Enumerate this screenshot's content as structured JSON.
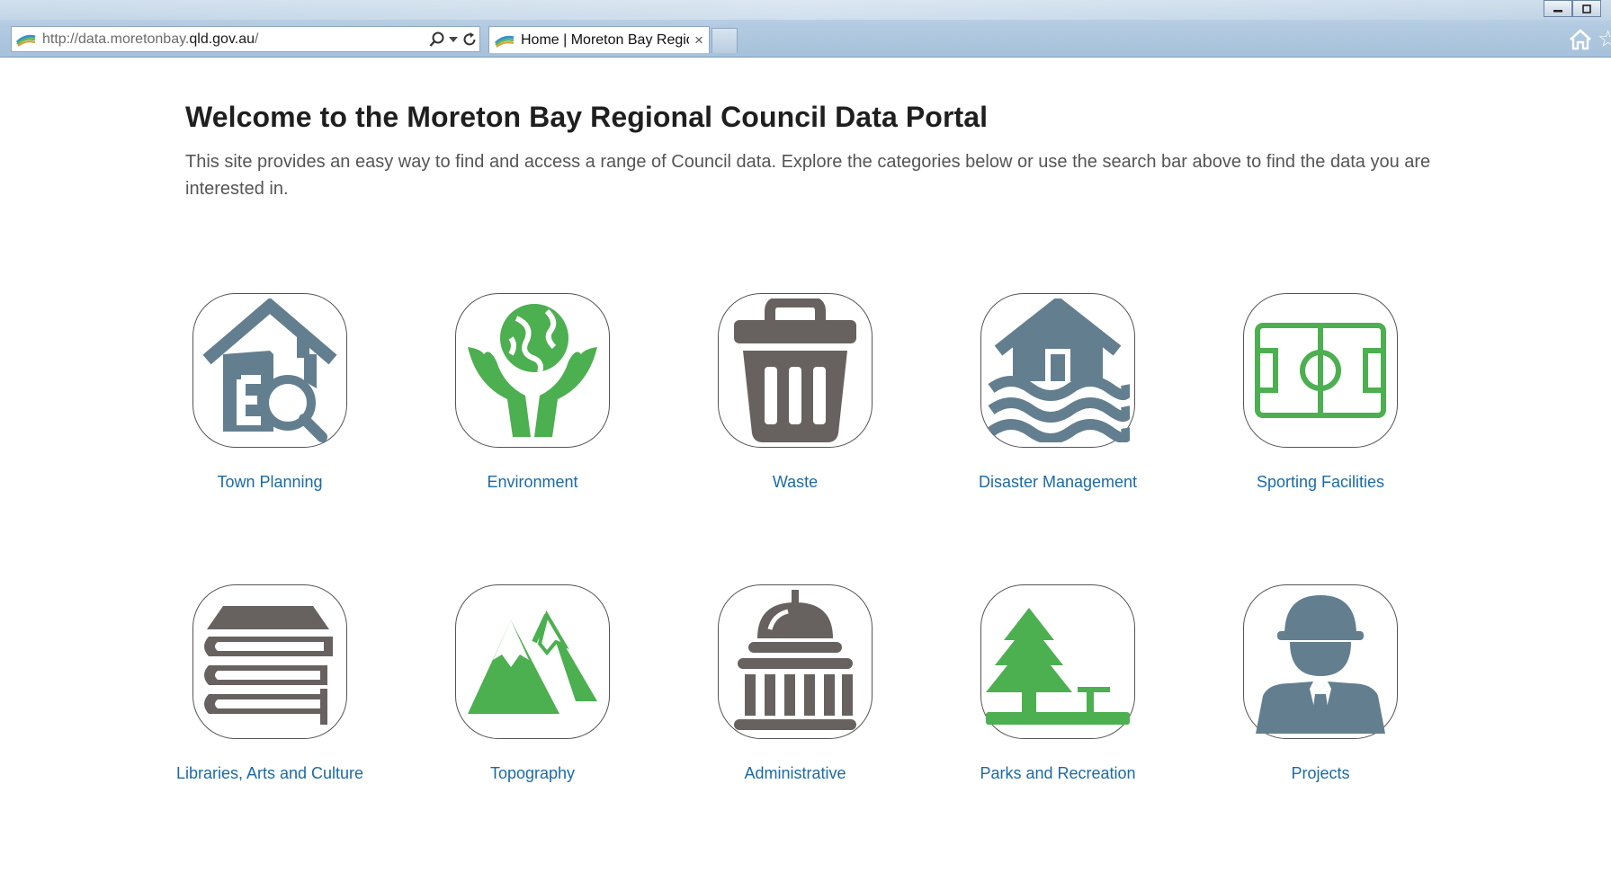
{
  "browser": {
    "url_prefix": "http://data.moretonbay.",
    "url_domain": "qld.gov.au",
    "url_suffix": "/",
    "tab_title": "Home | Moreton Bay Regio...",
    "tab_close": "×"
  },
  "page": {
    "title": "Welcome to the Moreton Bay Regional Council Data Portal",
    "intro": "This site provides an easy way to find and access a range of Council data. Explore the categories below or use the search bar above to find the data you are interested in."
  },
  "categories": [
    {
      "label": "Town Planning",
      "icon": "house-search-icon",
      "color": "#637f8f"
    },
    {
      "label": "Environment",
      "icon": "hands-globe-icon",
      "color": "#4caf50"
    },
    {
      "label": "Waste",
      "icon": "trash-bin-icon",
      "color": "#676260"
    },
    {
      "label": "Disaster Management",
      "icon": "flood-house-icon",
      "color": "#637f8f"
    },
    {
      "label": "Sporting Facilities",
      "icon": "sports-field-icon",
      "color": "#4caf50"
    },
    {
      "label": "Libraries, Arts and Culture",
      "icon": "books-stack-icon",
      "color": "#676260"
    },
    {
      "label": "Topography",
      "icon": "mountains-icon",
      "color": "#4caf50"
    },
    {
      "label": "Administrative",
      "icon": "capitol-building-icon",
      "color": "#676260"
    },
    {
      "label": "Parks and Recreation",
      "icon": "tree-bench-icon",
      "color": "#4caf50"
    },
    {
      "label": "Projects",
      "icon": "hard-hat-worker-icon",
      "color": "#637f8f"
    }
  ],
  "colors": {
    "link": "#1b6aa8",
    "slate": "#637f8f",
    "green": "#4caf50",
    "dark_gray": "#676260"
  }
}
